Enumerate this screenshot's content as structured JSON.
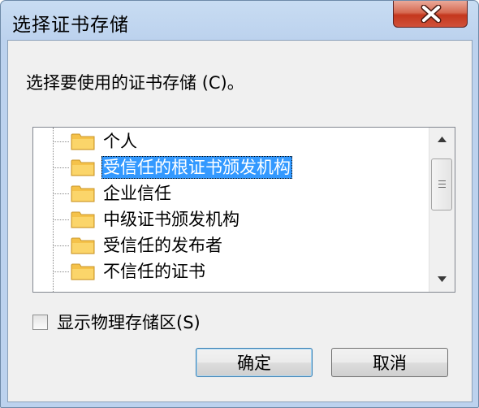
{
  "window": {
    "title": "选择证书存储"
  },
  "dialog": {
    "prompt": "选择要使用的证书存储",
    "prompt_accel": "(C)",
    "prompt_suffix": "。",
    "stores": [
      {
        "label": "个人",
        "selected": false
      },
      {
        "label": "受信任的根证书颁发机构",
        "selected": true
      },
      {
        "label": "企业信任",
        "selected": false
      },
      {
        "label": "中级证书颁发机构",
        "selected": false
      },
      {
        "label": "受信任的发布者",
        "selected": false
      },
      {
        "label": "不信任的证书",
        "selected": false
      }
    ],
    "show_physical": {
      "label": "显示物理存储区",
      "accel": "(S)",
      "checked": false
    },
    "ok_label": "确定",
    "cancel_label": "取消"
  },
  "colors": {
    "selection": "#3399ff",
    "folder": "#f5c24a",
    "close_button": "#c4371d"
  },
  "icons": {
    "folder": "folder-icon",
    "close": "close-icon",
    "scroll_up": "arrow-up-icon",
    "scroll_down": "arrow-down-icon"
  }
}
